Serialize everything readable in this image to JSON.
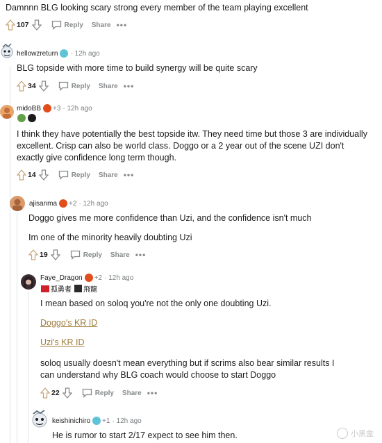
{
  "comments": [
    {
      "id": "c0",
      "text": "Damnnn BLG looking scary strong every member of the team playing excellent",
      "votes": "107",
      "reply_label": "Reply",
      "share_label": "Share"
    },
    {
      "id": "c1",
      "username": "hellowzreturn",
      "time": "12h ago",
      "text": "BLG topside with more time to build synergy will be quite scary",
      "votes": "34",
      "reply_label": "Reply",
      "share_label": "Share"
    },
    {
      "id": "c2",
      "username": "midoBB",
      "flair_extra": "+3",
      "time": "12h ago",
      "text": "I think they have potentially the best topside itw. They need time but those 3 are individually excellent. Crisp can also be world class. Doggo or a 2 year out of the scene UZI don't exactly give confidence long term though.",
      "votes": "14",
      "reply_label": "Reply",
      "share_label": "Share"
    },
    {
      "id": "c3",
      "username": "ajisanma",
      "flair_extra": "+2",
      "time": "12h ago",
      "text_1": "Doggo gives me more confidence than Uzi, and the confidence isn't much",
      "text_2": "Im one of the minority heavily doubting Uzi",
      "votes": "19",
      "reply_label": "Reply",
      "share_label": "Share"
    },
    {
      "id": "c4",
      "username": "Faye_Dragon",
      "flair_extra": "+2",
      "time": "12h ago",
      "flair_1": "孤勇者",
      "flair_2": "飛龍",
      "text_1": "I mean based on soloq you're not the only one doubting Uzi.",
      "link_1": "Doggo's KR ID",
      "link_2": "Uzi's KR ID",
      "text_2": "soloq usually doesn't mean everything but if scrims also bear similar results I can understand why BLG coach would choose to start Doggo",
      "votes": "22",
      "reply_label": "Reply",
      "share_label": "Share"
    },
    {
      "id": "c5",
      "username": "keishinichiro",
      "flair_extra": "+1",
      "time": "12h ago",
      "text": "He is rumor to start 2/17 expect to see him then."
    }
  ],
  "watermark": "小黑盒",
  "colors": {
    "link": "#a07b3a",
    "muted": "#878a8c",
    "thread": "#e0e3e6"
  }
}
